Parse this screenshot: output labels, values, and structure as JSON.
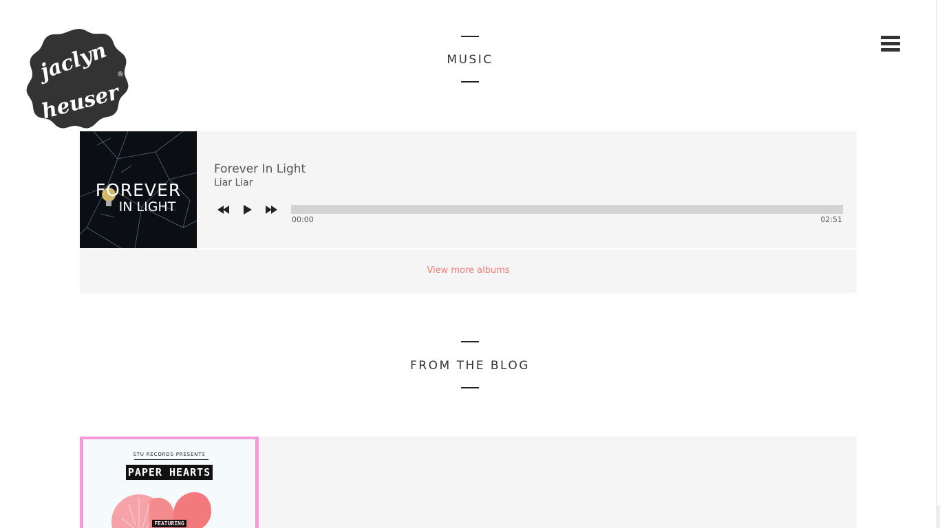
{
  "brand": {
    "logo_line1": "jaclyn",
    "logo_line2": "heuser",
    "logo_mark": "®",
    "logo_color": "#333333"
  },
  "header": {
    "menu_icon": "hamburger-menu-icon"
  },
  "music": {
    "section_title": "MUSIC",
    "player": {
      "cover_title_line1": "FOREVER",
      "cover_title_line2": "IN LIGHT",
      "track_title": "Forever In Light",
      "artist": "Liar Liar",
      "controls": {
        "prev_icon": "rewind-icon",
        "play_icon": "play-icon",
        "next_icon": "fast-forward-icon"
      },
      "current_time": "00:00",
      "duration": "02:51",
      "progress_fraction": 0
    },
    "view_more_label": "View more albums",
    "accent_color": "#ee7c79"
  },
  "blog": {
    "section_title": "FROM THE BLOG",
    "posts": [
      {
        "thumb_presents": "STU RECORDS PRESENTS",
        "thumb_title": "PAPER HEARTS",
        "thumb_featuring": "FEATURING",
        "thumb_border_color": "#f39ad7"
      }
    ]
  }
}
